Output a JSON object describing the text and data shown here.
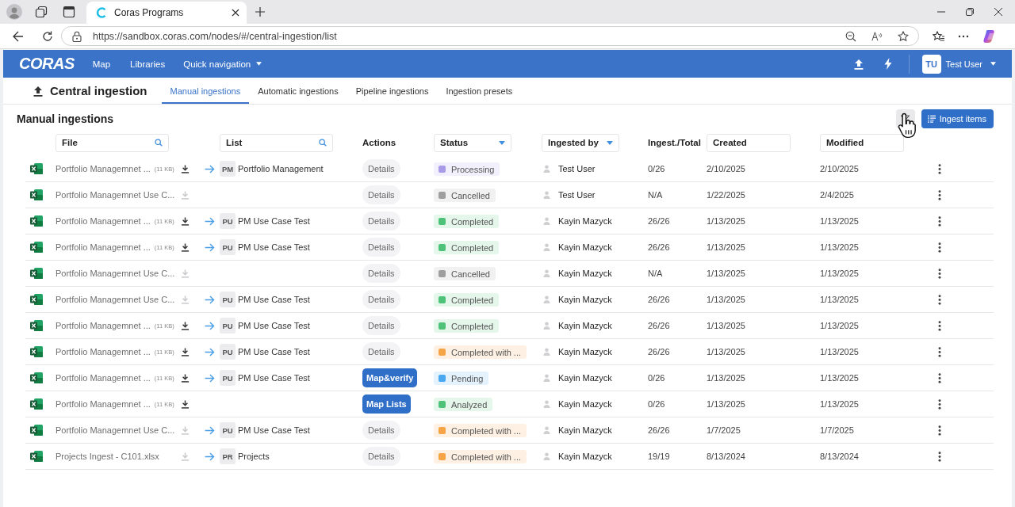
{
  "browser": {
    "tab_title": "Coras Programs",
    "url": "https://sandbox.coras.com/nodes/#/central-ingestion/list"
  },
  "app_header": {
    "logo": "CORAS",
    "nav": [
      {
        "label": "Map",
        "menu": false
      },
      {
        "label": "Libraries",
        "menu": false
      },
      {
        "label": "Quick navigation",
        "menu": true
      }
    ],
    "user": {
      "initials": "TU",
      "name": "Test User"
    }
  },
  "page": {
    "title": "Central ingestion",
    "tabs": [
      {
        "label": "Manual ingestions",
        "selected": true
      },
      {
        "label": "Automatic ingestions",
        "selected": false
      },
      {
        "label": "Pipeline ingestions",
        "selected": false
      },
      {
        "label": "Ingestion presets",
        "selected": false
      }
    ]
  },
  "section": {
    "title": "Manual ingestions",
    "ingest_button": "Ingest items"
  },
  "table": {
    "columns": [
      {
        "kind": "search",
        "label": "File"
      },
      {
        "kind": "search",
        "label": "List"
      },
      {
        "kind": "plain",
        "label": "Actions"
      },
      {
        "kind": "dropdown",
        "label": "Status"
      },
      {
        "kind": "dropdown",
        "label": "Ingested by"
      },
      {
        "kind": "plain",
        "label": "Ingest./Total"
      },
      {
        "kind": "field",
        "label": "Created"
      },
      {
        "kind": "field",
        "label": "Modified"
      }
    ],
    "rows": [
      {
        "file": "Portfolio Managemnet ...",
        "size": "(11 KB)",
        "download_disabled": false,
        "list": {
          "code": "PM",
          "name": "Portfolio Management"
        },
        "action": {
          "kind": "details",
          "label": "Details"
        },
        "status": {
          "label": "Processing",
          "color": "#a99be8"
        },
        "ingested_by": "Test User",
        "ingested_total": "0/26",
        "created": "2/10/2025",
        "modified": "2/10/2025"
      },
      {
        "file": "Portfolio Managemnet Use C...",
        "download_disabled": true,
        "action": {
          "kind": "details",
          "label": "Details"
        },
        "status": {
          "label": "Cancelled",
          "color": "#9e9e9e"
        },
        "ingested_by": "Test User",
        "ingested_total": "N/A",
        "created": "1/22/2025",
        "modified": "2/4/2025"
      },
      {
        "file": "Portfolio Managemnet ...",
        "size": "(11 KB)",
        "download_disabled": false,
        "list": {
          "code": "PU",
          "name": "PM Use Case Test"
        },
        "action": {
          "kind": "details",
          "label": "Details"
        },
        "status": {
          "label": "Completed",
          "color": "#4fc27a"
        },
        "ingested_by": "Kayin Mazyck",
        "ingested_total": "26/26",
        "created": "1/13/2025",
        "modified": "1/13/2025"
      },
      {
        "file": "Portfolio Managemnet ...",
        "size": "(11 KB)",
        "download_disabled": false,
        "list": {
          "code": "PU",
          "name": "PM Use Case Test"
        },
        "action": {
          "kind": "details",
          "label": "Details"
        },
        "status": {
          "label": "Completed",
          "color": "#4fc27a"
        },
        "ingested_by": "Kayin Mazyck",
        "ingested_total": "26/26",
        "created": "1/13/2025",
        "modified": "1/13/2025"
      },
      {
        "file": "Portfolio Managemnet Use C...",
        "download_disabled": true,
        "action": {
          "kind": "details",
          "label": "Details"
        },
        "status": {
          "label": "Cancelled",
          "color": "#9e9e9e"
        },
        "ingested_by": "Kayin Mazyck",
        "ingested_total": "N/A",
        "created": "1/13/2025",
        "modified": "1/13/2025"
      },
      {
        "file": "Portfolio Managemnet Use C...",
        "download_disabled": true,
        "list": {
          "code": "PU",
          "name": "PM Use Case Test"
        },
        "action": {
          "kind": "details",
          "label": "Details"
        },
        "status": {
          "label": "Completed",
          "color": "#4fc27a"
        },
        "ingested_by": "Kayin Mazyck",
        "ingested_total": "26/26",
        "created": "1/13/2025",
        "modified": "1/13/2025"
      },
      {
        "file": "Portfolio Managemnet ...",
        "size": "(11 KB)",
        "download_disabled": false,
        "list": {
          "code": "PU",
          "name": "PM Use Case Test"
        },
        "action": {
          "kind": "details",
          "label": "Details"
        },
        "status": {
          "label": "Completed",
          "color": "#4fc27a"
        },
        "ingested_by": "Kayin Mazyck",
        "ingested_total": "26/26",
        "created": "1/13/2025",
        "modified": "1/13/2025"
      },
      {
        "file": "Portfolio Managemnet ...",
        "size": "(11 KB)",
        "download_disabled": false,
        "list": {
          "code": "PU",
          "name": "PM Use Case Test"
        },
        "action": {
          "kind": "details",
          "label": "Details"
        },
        "status": {
          "label": "Completed with ...",
          "color": "#f5a446"
        },
        "ingested_by": "Kayin Mazyck",
        "ingested_total": "26/26",
        "created": "1/13/2025",
        "modified": "1/13/2025"
      },
      {
        "file": "Portfolio Managemnet ...",
        "size": "(11 KB)",
        "download_disabled": false,
        "list": {
          "code": "PU",
          "name": "PM Use Case Test"
        },
        "action": {
          "kind": "primary",
          "label": "Map&verify"
        },
        "status": {
          "label": "Pending",
          "color": "#4aa8f0"
        },
        "ingested_by": "Kayin Mazyck",
        "ingested_total": "0/26",
        "created": "1/13/2025",
        "modified": "1/13/2025"
      },
      {
        "file": "Portfolio Managemnet ...",
        "size": "(11 KB)",
        "download_disabled": false,
        "action": {
          "kind": "primary",
          "label": "Map Lists"
        },
        "status": {
          "label": "Analyzed",
          "color": "#4fc27a"
        },
        "ingested_by": "Kayin Mazyck",
        "ingested_total": "0/26",
        "created": "1/13/2025",
        "modified": "1/13/2025"
      },
      {
        "file": "Portfolio Managemnet Use C...",
        "download_disabled": true,
        "list": {
          "code": "PU",
          "name": "PM Use Case Test"
        },
        "action": {
          "kind": "details",
          "label": "Details"
        },
        "status": {
          "label": "Completed with ...",
          "color": "#f5a446"
        },
        "ingested_by": "Kayin Mazyck",
        "ingested_total": "26/26",
        "created": "1/7/2025",
        "modified": "1/7/2025"
      },
      {
        "file": "Projects Ingest - C101.xlsx",
        "download_disabled": true,
        "list": {
          "code": "PR",
          "name": "Projects"
        },
        "action": {
          "kind": "details",
          "label": "Details"
        },
        "status": {
          "label": "Completed with ...",
          "color": "#f5a446"
        },
        "ingested_by": "Kayin Mazyck",
        "ingested_total": "19/19",
        "created": "8/13/2024",
        "modified": "8/13/2024"
      }
    ]
  }
}
